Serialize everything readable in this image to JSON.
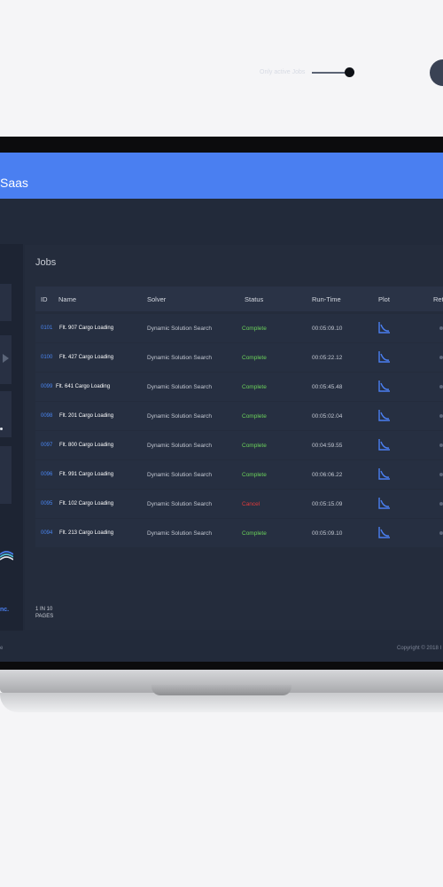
{
  "app": {
    "title": "Saas"
  },
  "toolbar": {
    "toggle_label": "Only active Jobs",
    "toggle_on": true
  },
  "main": {
    "title": "Jobs"
  },
  "table": {
    "columns": [
      "ID",
      "Name",
      "Solver",
      "Status",
      "Run-Time",
      "Plot",
      "Ret"
    ],
    "rows": [
      {
        "id": "0101",
        "name": "Flt. 907 Cargo Loading",
        "solver": "Dynamic Solution Search",
        "status": "Complete",
        "runtime": "00:05:09.10"
      },
      {
        "id": "0100",
        "name": "Flt. 427 Cargo Loading",
        "solver": "Dynamic Solution Search",
        "status": "Complete",
        "runtime": "00:05:22.12"
      },
      {
        "id": "0099",
        "name": "Flt. 641 Cargo Loading",
        "solver": "Dynamic Solution Search",
        "status": "Complete",
        "runtime": "00:05:45.48"
      },
      {
        "id": "0098",
        "name": "Flt. 201 Cargo Loading",
        "solver": "Dynamic Solution Search",
        "status": "Complete",
        "runtime": "00:05:02.04"
      },
      {
        "id": "0097",
        "name": "Flt. 800 Cargo Loading",
        "solver": "Dynamic Solution Search",
        "status": "Complete",
        "runtime": "00:04:59.55"
      },
      {
        "id": "0096",
        "name": "Flt. 991 Cargo Loading",
        "solver": "Dynamic Solution Search",
        "status": "Complete",
        "runtime": "00:06:06.22"
      },
      {
        "id": "0095",
        "name": "Flt. 102 Cargo Loading",
        "solver": "Dynamic Solution Search",
        "status": "Cancel",
        "runtime": "00:05:15.09"
      },
      {
        "id": "0094",
        "name": "Flt. 213 Cargo Loading",
        "solver": "Dynamic Solution Search",
        "status": "Complete",
        "runtime": "00:05:09.10"
      }
    ]
  },
  "pager": {
    "count_line1": "1 IN 10",
    "count_line2": "PAGES"
  },
  "sidebar": {
    "brand": "nc."
  },
  "footer": {
    "left": "e",
    "right": "Copyright © 2018 I"
  },
  "colors": {
    "accent": "#4a7ff1",
    "complete": "#6bd15a",
    "cancel": "#e23a3a"
  },
  "icons": {
    "plot": "chart-line-icon"
  }
}
